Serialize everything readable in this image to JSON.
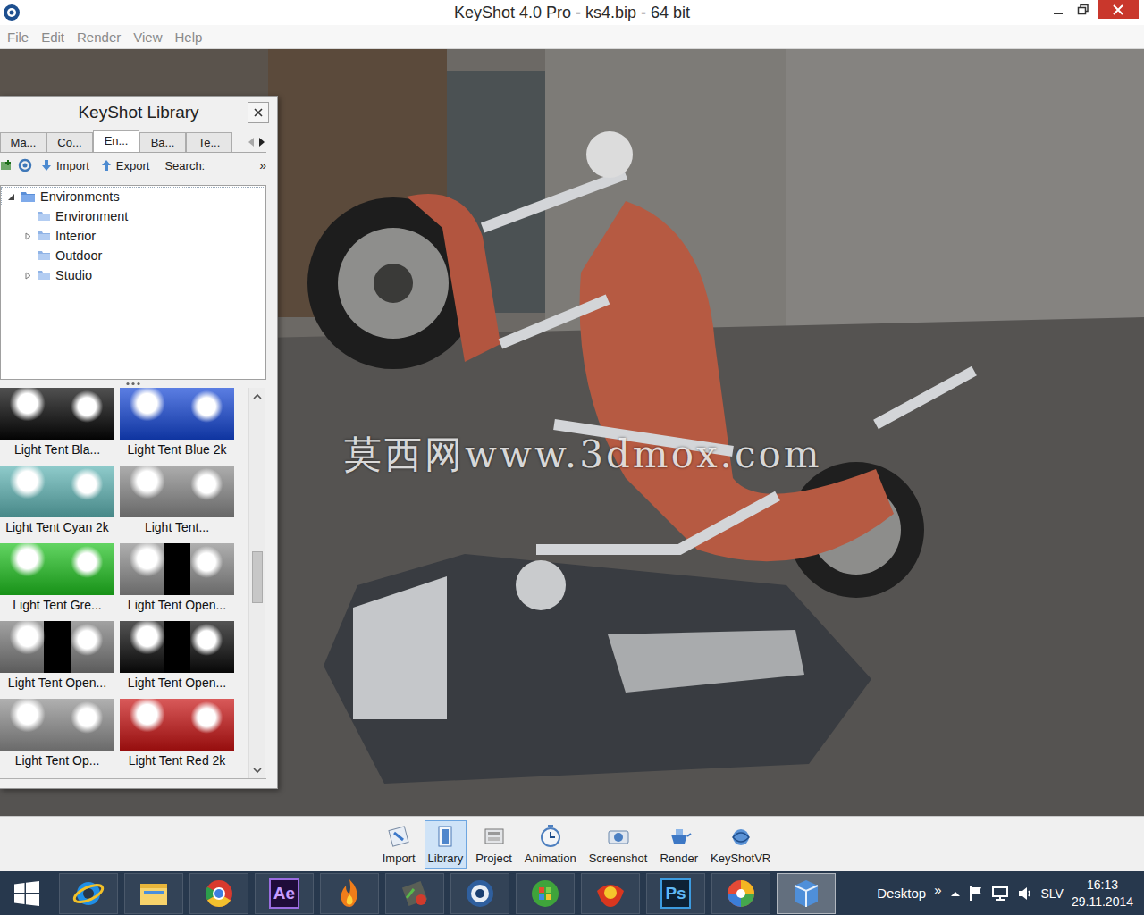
{
  "window": {
    "title": "KeyShot 4.0 Pro  - ks4.bip  - 64 bit"
  },
  "menu": [
    "File",
    "Edit",
    "Render",
    "View",
    "Help"
  ],
  "viewport": {
    "watermark": "莫西网www.3dmox.com"
  },
  "library": {
    "title": "KeyShot Library",
    "tabs": [
      {
        "label": "Ma...",
        "selected": false
      },
      {
        "label": "Co...",
        "selected": false
      },
      {
        "label": "En...",
        "selected": true
      },
      {
        "label": "Ba...",
        "selected": false
      },
      {
        "label": "Te...",
        "selected": false
      }
    ],
    "tab_scroll": {
      "back_enabled": false,
      "forward_enabled": true
    },
    "toolbar": {
      "import": "Import",
      "export": "Export",
      "search_label": "Search:",
      "more": "»"
    },
    "tree": {
      "label": "Environments",
      "expandable": true,
      "expanded": true,
      "selected": true,
      "children": [
        {
          "label": "Environment",
          "expandable": false,
          "expanded": false
        },
        {
          "label": "Interior",
          "expandable": true,
          "expanded": false
        },
        {
          "label": "Outdoor",
          "expandable": false,
          "expanded": false
        },
        {
          "label": "Studio",
          "expandable": true,
          "expanded": false
        }
      ]
    },
    "thumbnails": [
      {
        "label": "Light Tent Bla...",
        "color": "#050505",
        "kind": "closed"
      },
      {
        "label": "Light Tent Blue 2k",
        "color": "#1446d6",
        "kind": "closed"
      },
      {
        "label": "Light Tent Cyan 2k",
        "color": "#5fb5b5",
        "kind": "closed"
      },
      {
        "label": "Light Tent...",
        "color": "#8a8a8a",
        "kind": "closed"
      },
      {
        "label": "Light Tent Gre...",
        "color": "#1fc21f",
        "kind": "closed"
      },
      {
        "label": "Light Tent Open...",
        "color": "#8c8c8c",
        "kind": "open"
      },
      {
        "label": "Light Tent Open...",
        "color": "#7a7a7a",
        "kind": "open"
      },
      {
        "label": "Light Tent Open...",
        "color": "#0a0a0a",
        "kind": "open"
      },
      {
        "label": "Light Tent Op...",
        "color": "#8e8e8e",
        "kind": "closed"
      },
      {
        "label": "Light Tent Red 2k",
        "color": "#c81212",
        "kind": "closed"
      }
    ],
    "scroll": {
      "level": 0.48
    }
  },
  "toolbar": [
    {
      "label": "Import",
      "kind": "import",
      "selected": false
    },
    {
      "label": "Library",
      "kind": "library",
      "selected": true
    },
    {
      "label": "Project",
      "kind": "project",
      "selected": false
    },
    {
      "label": "Animation",
      "kind": "animation",
      "selected": false
    },
    {
      "label": "Screenshot",
      "kind": "screenshot",
      "selected": false
    },
    {
      "label": "Render",
      "kind": "render",
      "selected": false
    },
    {
      "label": "KeyShotVR",
      "kind": "vr",
      "selected": false
    }
  ],
  "taskbar": {
    "apps": [
      {
        "kind": "ie",
        "text": "",
        "selected": false
      },
      {
        "kind": "folder",
        "text": "",
        "selected": false
      },
      {
        "kind": "chrome",
        "text": "",
        "selected": false
      },
      {
        "kind": "ae",
        "text": "Ae",
        "selected": false
      },
      {
        "kind": "flame",
        "text": "",
        "selected": false
      },
      {
        "kind": "media",
        "text": "",
        "selected": false
      },
      {
        "kind": "keyshot",
        "text": "",
        "selected": false
      },
      {
        "kind": "orb",
        "text": "",
        "selected": false
      },
      {
        "kind": "bird",
        "text": "",
        "selected": false
      },
      {
        "kind": "ps",
        "text": "Ps",
        "selected": false
      },
      {
        "kind": "picasa",
        "text": "",
        "selected": false
      },
      {
        "kind": "vr",
        "text": "",
        "selected": true
      }
    ],
    "desktop": "Desktop",
    "more": "»",
    "language": "SLV",
    "time": "16:13",
    "date": "29.11.2014"
  }
}
